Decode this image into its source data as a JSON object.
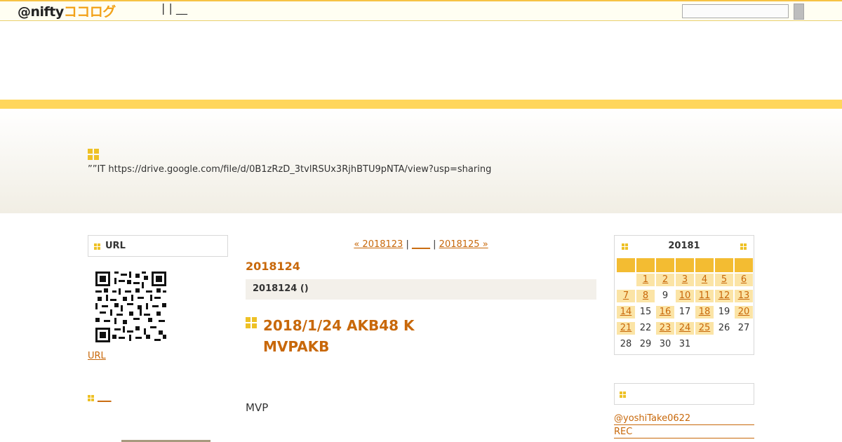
{
  "header": {
    "logo_prefix": "@nifty",
    "logo_brand": "ココログ",
    "nav_text": "| | __",
    "search_placeholder": ""
  },
  "hero": {
    "description": "””IT  https://drive.google.com/file/d/0B1zRzD_3tvlRSUx3RjhBTU9pNTA/view?usp=sharing"
  },
  "left_sidebar": {
    "url_title": "URL",
    "url_link": "URL",
    "section2_link": "___"
  },
  "main": {
    "prev_month": "« 2018123",
    "sep1": "|",
    "top_link": "____",
    "sep2": "|",
    "next_month": "2018125 »",
    "archive_title": "2018124",
    "date_header": "2018124 ()",
    "entry_title_line1": "2018/1/24 AKB48 K",
    "entry_title_line2": "MVPAKB",
    "entry_body": "MVP"
  },
  "calendar": {
    "title": "20181",
    "weekdays": [
      "",
      "",
      "",
      "",
      "",
      "",
      ""
    ],
    "days": [
      {
        "d": ""
      },
      {
        "d": "1",
        "link": true
      },
      {
        "d": "2",
        "link": true
      },
      {
        "d": "3",
        "link": true
      },
      {
        "d": "4",
        "link": true
      },
      {
        "d": "5",
        "link": true
      },
      {
        "d": "6",
        "link": true
      },
      {
        "d": "7",
        "link": true
      },
      {
        "d": "8",
        "link": true
      },
      {
        "d": "9"
      },
      {
        "d": "10",
        "link": true
      },
      {
        "d": "11",
        "link": true
      },
      {
        "d": "12",
        "link": true
      },
      {
        "d": "13",
        "link": true
      },
      {
        "d": "14",
        "link": true
      },
      {
        "d": "15"
      },
      {
        "d": "16",
        "link": true
      },
      {
        "d": "17"
      },
      {
        "d": "18",
        "link": true
      },
      {
        "d": "19"
      },
      {
        "d": "20",
        "link": true
      },
      {
        "d": "21",
        "link": true
      },
      {
        "d": "22"
      },
      {
        "d": "23",
        "link": true
      },
      {
        "d": "24",
        "link": true
      },
      {
        "d": "25",
        "link": true
      },
      {
        "d": "26"
      },
      {
        "d": "27"
      },
      {
        "d": "28"
      },
      {
        "d": "29"
      },
      {
        "d": "30"
      },
      {
        "d": "31"
      }
    ]
  },
  "twitter": {
    "title": "",
    "handle": "@yoshiTake0622",
    "item2": "REC"
  },
  "colors": {
    "accent": "#c8680a",
    "stripe": "#ffd65c",
    "icon": "#eec126"
  }
}
